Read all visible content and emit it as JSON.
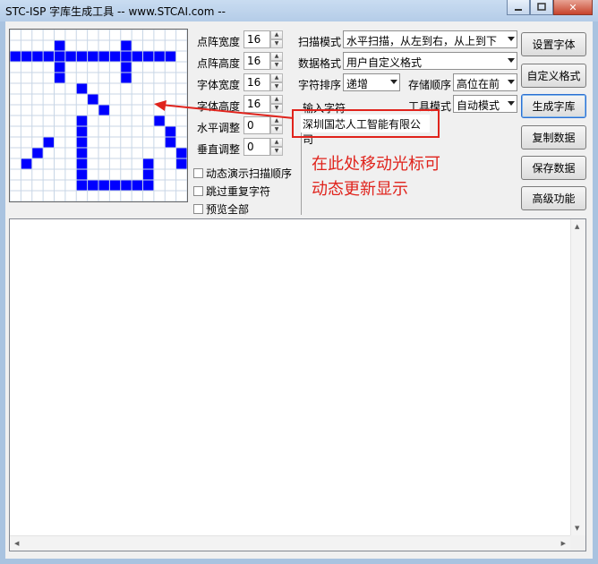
{
  "window": {
    "title": "STC-ISP 字库生成工具 -- www.STCAI.com --",
    "close_label": "✕"
  },
  "preview": {
    "cols": 16,
    "rows": 16,
    "on_color": "#0000ff",
    "grid_color": "#c8d6e6",
    "pixels": [
      "0000000000000000",
      "0000100000100000",
      "1111111111111110",
      "0000100000100000",
      "0000100000100000",
      "0000001000000000",
      "0000000100000000",
      "0000000010000000",
      "0000001000000100",
      "0000001000000010",
      "0001001000000010",
      "0010001000000001",
      "0100001000001001",
      "0000001000001000",
      "0000001111111000",
      "0000000000000000"
    ]
  },
  "params": [
    {
      "label": "点阵宽度",
      "value": "16"
    },
    {
      "label": "点阵高度",
      "value": "16"
    },
    {
      "label": "字体宽度",
      "value": "16"
    },
    {
      "label": "字体高度",
      "value": "16"
    },
    {
      "label": "水平调整",
      "value": "0"
    },
    {
      "label": "垂直调整",
      "value": "0"
    }
  ],
  "checkboxes": [
    {
      "label": "动态演示扫描顺序",
      "checked": false
    },
    {
      "label": "跳过重复字符",
      "checked": false
    },
    {
      "label": "预览全部",
      "checked": false
    }
  ],
  "settings": {
    "scan_mode": {
      "label": "扫描模式",
      "value": "水平扫描，从左到右，从上到下"
    },
    "data_format": {
      "label": "数据格式",
      "value": "用户自定义格式"
    },
    "char_order": {
      "label": "字符排序",
      "value": "递增"
    },
    "storage_order": {
      "label": "存储顺序",
      "value": "高位在前"
    },
    "tool_mode": {
      "label": "工具模式",
      "value": "自动模式"
    }
  },
  "input": {
    "label": "输入字符",
    "value": "深圳国芯人工智能有限公司"
  },
  "annotation": {
    "line1": "在此处移动光标可",
    "line2": "动态更新显示",
    "color": "#e0231c"
  },
  "buttons": {
    "set_font": "设置字体",
    "custom_format": "自定义格式",
    "generate": "生成字库",
    "copy": "复制数据",
    "save": "保存数据",
    "advanced": "高级功能"
  }
}
